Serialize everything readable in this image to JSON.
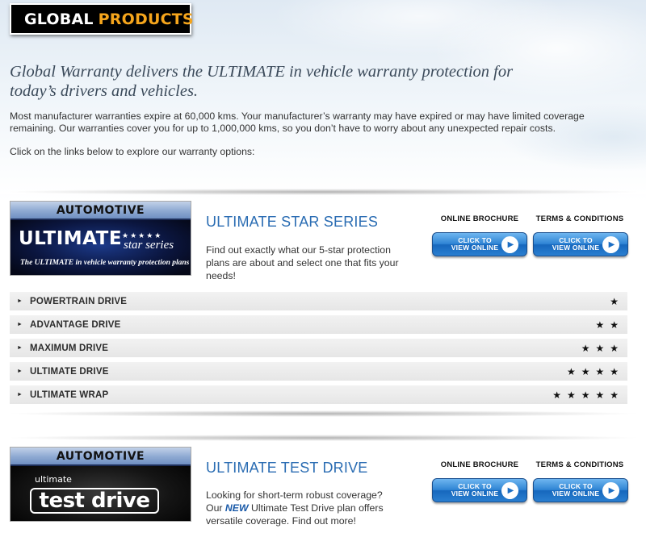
{
  "logo": {
    "word1": "GLOBAL",
    "word2": "PRODUCTS"
  },
  "intro": {
    "headline": "Global Warranty delivers the ULTIMATE in vehicle warranty protection for today’s drivers and vehicles.",
    "paragraph1": "Most manufacturer warranties expire at 60,000 kms. Your manufacturer’s warranty may have expired or may have limited coverage remaining. Our warranties cover you for up to 1,000,000 kms, so you don’t have to worry about any unexpected repair costs.",
    "paragraph2": "Click on the links below to explore our warranty options:"
  },
  "sections": [
    {
      "banner": {
        "category": "AUTOMOTIVE",
        "title": "ULTIMATE",
        "stars": "★★★★★",
        "subtitle": "star series",
        "tagline": "The ULTIMATE in vehicle warranty protection plans"
      },
      "title": "ULTIMATE STAR SERIES",
      "description": "Find out exactly what our 5-star protection plans are about and select one that fits your needs!",
      "brochure_label": "ONLINE BROCHURE",
      "terms_label": "TERMS & CONDITIONS",
      "button_text_line1": "CLICK TO",
      "button_text_line2": "VIEW ONLINE",
      "plans": [
        {
          "name": "POWERTRAIN DRIVE",
          "stars": "★"
        },
        {
          "name": "ADVANTAGE DRIVE",
          "stars": "★★"
        },
        {
          "name": "MAXIMUM DRIVE",
          "stars": "★★★"
        },
        {
          "name": "ULTIMATE DRIVE",
          "stars": "★★★★"
        },
        {
          "name": "ULTIMATE WRAP",
          "stars": "★★★★★"
        }
      ]
    },
    {
      "banner": {
        "category": "AUTOMOTIVE",
        "small": "ultimate",
        "title": "test drive"
      },
      "title": "ULTIMATE TEST DRIVE",
      "description_pre": "Looking for short-term robust coverage? Our ",
      "description_new": "NEW",
      "description_post": " Ultimate Test Drive plan offers versatile coverage. Find out more!",
      "brochure_label": "ONLINE BROCHURE",
      "terms_label": "TERMS & CONDITIONS",
      "button_text_line1": "CLICK TO",
      "button_text_line2": "VIEW ONLINE"
    }
  ],
  "icons": {
    "row_arrow": "triangle-right-icon",
    "play": "play-circle-icon",
    "star": "star-icon"
  },
  "colors": {
    "accent_blue": "#2b6db3",
    "logo_orange": "#f5a51c"
  }
}
